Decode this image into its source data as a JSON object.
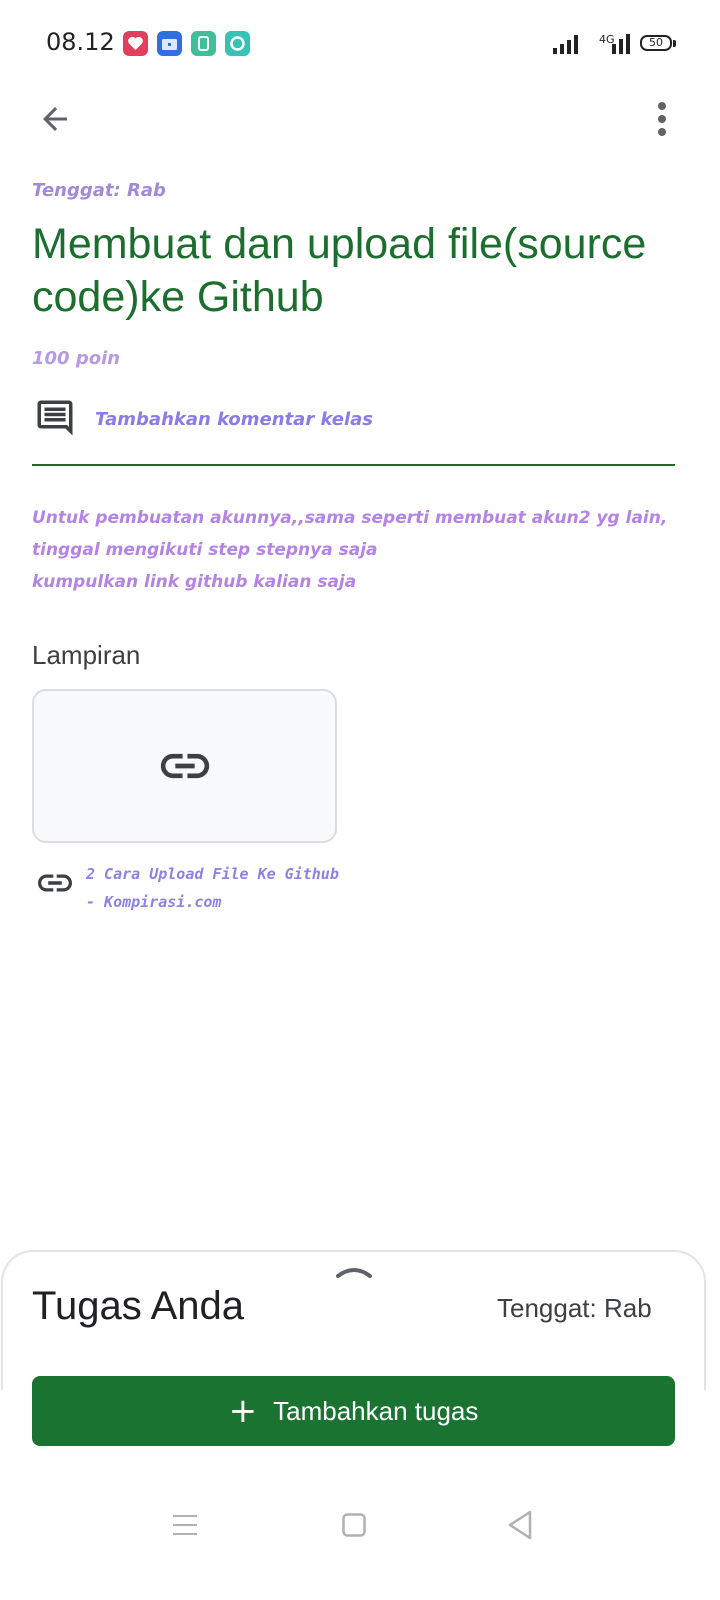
{
  "status_bar": {
    "time": "08.12",
    "network_type": "4G",
    "battery": "50"
  },
  "assignment": {
    "due": "Tenggat: Rab",
    "title": "Membuat dan upload file(source code)ke Github",
    "points": "100 poin",
    "add_class_comment": "Tambahkan komentar kelas",
    "description": "Untuk pembuatan akunnya,,sama seperti membuat akun2 yg lain,\ntinggal mengikuti step stepnya saja\nkumpulkan link github kalian saja"
  },
  "attachments": {
    "label": "Lampiran",
    "items": [
      {
        "title": "2 Cara Upload File Ke Github - Kompirasi.com",
        "icon": "link-icon"
      }
    ]
  },
  "bottom_sheet": {
    "title": "Tugas Anda",
    "due": "Tenggat: Rab",
    "add_button_label": "Tambahkan tugas"
  },
  "colors": {
    "primary_green": "#1a7331",
    "title_green": "#1b6e2e",
    "fancy_purple": "#b483e6"
  }
}
